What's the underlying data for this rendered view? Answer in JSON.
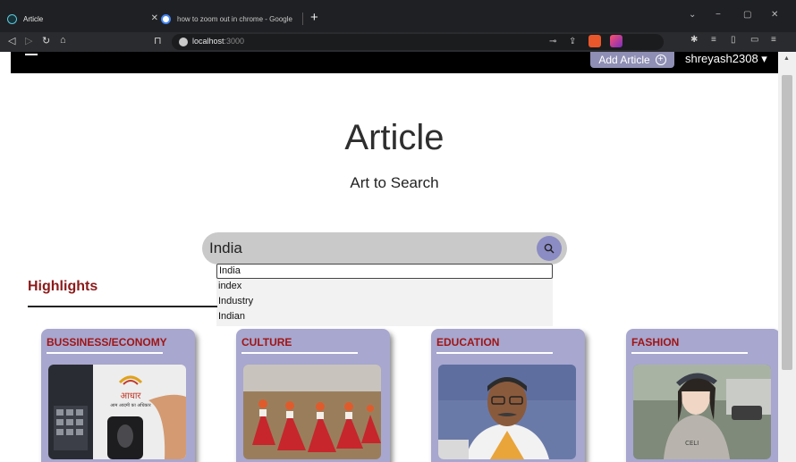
{
  "browser": {
    "tabs": [
      {
        "title": "Article",
        "active": true
      },
      {
        "title": "how to zoom out in chrome - Google",
        "active": false
      }
    ],
    "new_tab": "+",
    "url_host": "localhost",
    "url_port": ":3000",
    "window_controls": {
      "minimize": "−",
      "maximize": "▢",
      "close": "✕",
      "tab_search": "⌄"
    },
    "nav": {
      "back": "◁",
      "forward": "▷",
      "reload": "↻",
      "home": "⌂",
      "bookmark": "⊓"
    }
  },
  "navbar": {
    "add_article_label": "Add Article",
    "add_icon": "+",
    "username": "shreyash2308 ▾"
  },
  "hero": {
    "title": "Article",
    "subtitle": "Art to Search"
  },
  "search": {
    "value": "India",
    "icon": "search-icon",
    "suggestions": [
      "India",
      "index",
      "Industry",
      "Indian"
    ]
  },
  "highlights": {
    "heading": "Highlights"
  },
  "categories": [
    {
      "title": "BUSSINESS/ECONOMY",
      "image": "aadhaar-fingerprint-photo"
    },
    {
      "title": "CULTURE",
      "image": "folk-dancers-photo"
    },
    {
      "title": "EDUCATION",
      "image": "speaker-portrait-photo"
    },
    {
      "title": "FASHION",
      "image": "fashion-woman-photo"
    }
  ],
  "photo_text": {
    "aadhaar_hindi": "आधार",
    "aadhaar_tagline": "आम आदमी का अधिकार"
  },
  "colors": {
    "brand_card": "#a7a7cf",
    "category_title": "#a01515",
    "highlights": "#8b1a1a",
    "navbar": "#000000"
  }
}
